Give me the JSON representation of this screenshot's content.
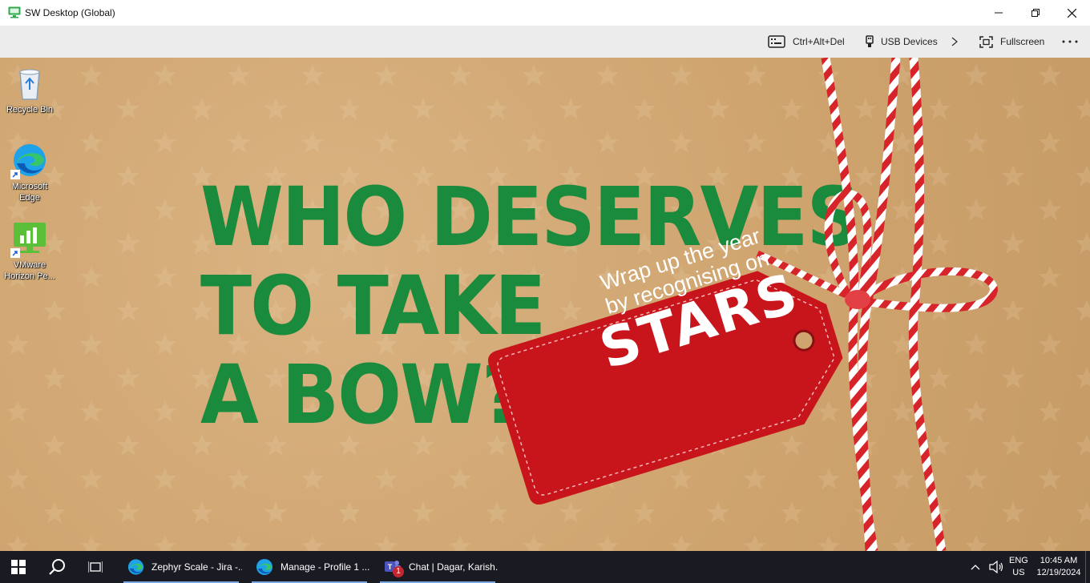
{
  "window": {
    "title": "SW Desktop (Global)"
  },
  "toolbar": {
    "ctrl_alt_del": "Ctrl+Alt+Del",
    "usb_devices": "USB Devices",
    "fullscreen": "Fullscreen"
  },
  "desktop_icons": [
    {
      "label": "Recycle Bin",
      "icon": "recycle-bin-icon"
    },
    {
      "label": "Microsoft Edge",
      "icon": "edge-icon"
    },
    {
      "label": "VMware Horizon Pe...",
      "icon": "vmware-horizon-icon"
    }
  ],
  "wallpaper": {
    "headline_line1": "WHO DESERVES",
    "headline_line2": "TO TAKE",
    "headline_line3": "A BOW?",
    "tag_line1": "Wrap up the year",
    "tag_line2": "by recognising on",
    "tag_brand": "STARS",
    "colors": {
      "green": "#1a8a3c",
      "red": "#c8151b",
      "kraft": "#cfa46f"
    }
  },
  "taskbar": {
    "apps": [
      {
        "label": "Zephyr Scale - Jira -...",
        "icon": "edge-icon"
      },
      {
        "label": "Manage - Profile 1 ...",
        "icon": "edge-icon"
      },
      {
        "label": "Chat | Dagar, Karish...",
        "icon": "teams-icon",
        "badge": "1"
      }
    ],
    "language": "ENG",
    "region": "US",
    "time": "10:45 AM",
    "date": "12/19/2024"
  }
}
